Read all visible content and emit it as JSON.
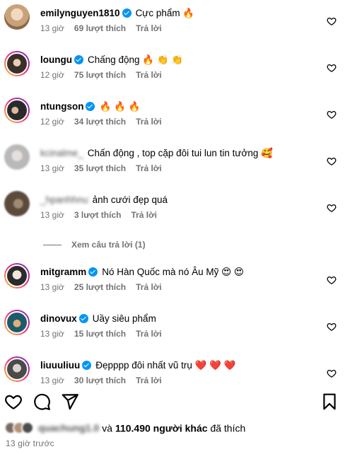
{
  "comments": [
    {
      "username": "emilynguyen1810",
      "verified": true,
      "blurred": false,
      "text": "Cực phẩm 🔥",
      "time": "13 giờ",
      "likes": "69 lượt thích",
      "reply": "Trả lời",
      "avatar_color": "#c9a27a"
    },
    {
      "username": "loungu",
      "verified": true,
      "blurred": false,
      "text": "Chấng động 🔥 👏 👏",
      "time": "12 giờ",
      "likes": "75 lượt thích",
      "reply": "Trả lời",
      "avatar_color": "#3b2f2a"
    },
    {
      "username": "ntungson",
      "verified": true,
      "blurred": false,
      "text": "🔥 🔥 🔥",
      "time": "12 giờ",
      "likes": "34 lượt thích",
      "reply": "Trả lời",
      "avatar_color": "#2a2a2a"
    },
    {
      "username": "kcinalme_",
      "verified": false,
      "blurred": true,
      "text": "Chấn động , top cặp đôi tui lun tin tưởng 🥰",
      "time": "13 giờ",
      "likes": "35 lượt thích",
      "reply": "Trả lời",
      "avatar_color": "#b9b9b9"
    },
    {
      "username": "_hpanhhnu",
      "verified": false,
      "blurred": true,
      "text": "ảnh cưới đẹp quá",
      "time": "13 giờ",
      "likes": "3 lượt thích",
      "reply": "Trả lời",
      "avatar_color": "#5c4a3a"
    },
    {
      "username": "mitgramm",
      "verified": true,
      "blurred": false,
      "text": "Nó Hàn Quốc mà nó Âu Mỹ 😍 😍",
      "time": "13 giờ",
      "likes": "25 lượt thích",
      "reply": "Trả lời",
      "avatar_color": "#e8ddd4"
    },
    {
      "username": "dinovux",
      "verified": true,
      "blurred": false,
      "text": "Uầy siêu phẩm",
      "time": "13 giờ",
      "likes": "15 lượt thích",
      "reply": "Trả lời",
      "avatar_color": "#1f5a6b"
    },
    {
      "username": "liuuuliuu",
      "verified": true,
      "blurred": false,
      "text": "Đẹpppp đôi nhất vũ trụ ❤️ ❤️ ❤️",
      "time": "13 giờ",
      "likes": "30 lượt thích",
      "reply": "Trả lời",
      "avatar_color": "#7d7d7d"
    }
  ],
  "view_replies": "Xem câu trả lời (1)",
  "actions": {
    "like_icon": "heart-outline-icon",
    "comment_icon": "comment-icon",
    "share_icon": "send-icon",
    "save_icon": "bookmark-icon"
  },
  "liked_by": {
    "name": "quachung1.0",
    "and": "và",
    "count": "110.490 người khác",
    "suffix": "đã thích"
  },
  "post_time": "13 giờ trước",
  "colors": {
    "verified_blue": "#0095f6",
    "meta_gray": "#737373"
  }
}
